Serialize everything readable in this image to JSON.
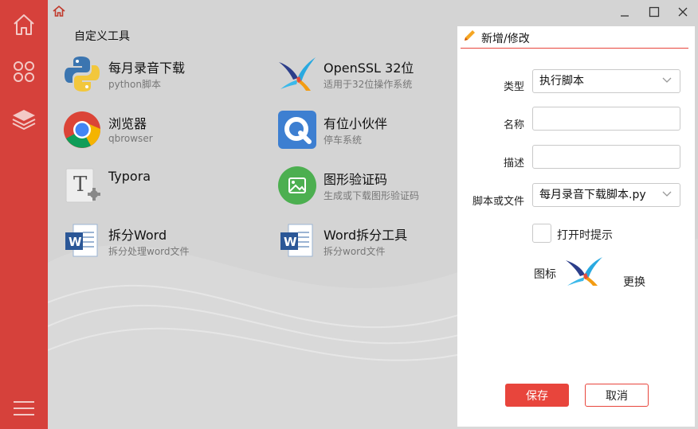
{
  "sidebar": {
    "items": [
      {
        "icon": "home-icon"
      },
      {
        "icon": "apps-icon"
      },
      {
        "icon": "layers-icon"
      },
      {
        "icon": "menu-icon"
      }
    ],
    "background": "#d6413b"
  },
  "header": {
    "home_icon": "home-icon",
    "window_controls": [
      "minimize-icon",
      "maximize-icon",
      "close-icon"
    ]
  },
  "main": {
    "section_title": "自定义工具",
    "tools": [
      {
        "name": "每月录音下载",
        "desc": "python脚本",
        "icon": "python-icon"
      },
      {
        "name": "OpenSSL 32位",
        "desc": "适用于32位操作系统",
        "icon": "openssl-icon"
      },
      {
        "name": "浏览器",
        "desc": "qbrowser",
        "icon": "chrome-icon"
      },
      {
        "name": "有位小伙伴",
        "desc": "停车系统",
        "icon": "parking-app-icon"
      },
      {
        "name": "Typora",
        "desc": "",
        "icon": "typora-icon"
      },
      {
        "name": "图形验证码",
        "desc": "生成或下载图形验证码",
        "icon": "image-icon"
      },
      {
        "name": "拆分Word",
        "desc": "拆分处理word文件",
        "icon": "word-icon"
      },
      {
        "name": "Word拆分工具",
        "desc": "拆分word文件",
        "icon": "word-icon"
      }
    ]
  },
  "dialog": {
    "title": "新增/修改",
    "type_label": "类型",
    "type_value": "执行脚本",
    "name_label": "名称",
    "name_value": "",
    "desc_label": "描述",
    "desc_value": "",
    "script_label": "脚本或文件",
    "script_value": "每月录音下载脚本.py",
    "open_prompt_label": "打开时提示",
    "open_prompt_checked": false,
    "icon_label": "图标",
    "icon_preview": "openssl-icon",
    "change_label": "更换",
    "save_label": "保存",
    "cancel_label": "取消"
  },
  "colors": {
    "accent": "#e8453c",
    "sidebar": "#d6413b",
    "main_bg": "#d4d4d4"
  }
}
